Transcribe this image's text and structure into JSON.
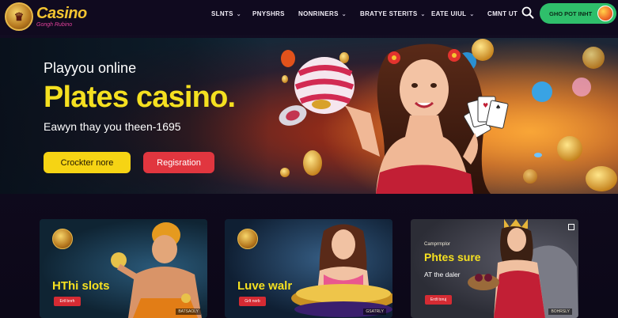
{
  "brand": {
    "name": "Casino",
    "tagline": "Gongh Rubino"
  },
  "nav": [
    {
      "label": "SLNTS",
      "has_menu": true
    },
    {
      "label": "PNYSHRS",
      "has_menu": false
    },
    {
      "label": "NONRINERS",
      "has_menu": true
    },
    {
      "label": "BRATYE STERITS",
      "has_menu": true
    },
    {
      "label": "EATE UIUL",
      "has_menu": true
    },
    {
      "label": "CMNT UT",
      "has_menu": false
    }
  ],
  "header": {
    "cta_label": "GHO POT INHT"
  },
  "hero": {
    "eyebrow": "Playyou online",
    "title": "Plates casino.",
    "subtitle": "Eawyn thay you theen-1695",
    "primary_button": "Crockter nore",
    "secondary_button": "Regisration"
  },
  "cards": [
    {
      "title": "HThi slots",
      "button": "Ertl bnrh",
      "tag": "BATSAOLY"
    },
    {
      "title": "Luve walr",
      "button": "Grlt norb",
      "tag": "GSATRLY"
    },
    {
      "kicker": "Camprmplor",
      "title": "Phtes sure",
      "subtitle": "AT the daler",
      "button": "Erdt toruj",
      "tag": "BOHRSLY"
    }
  ],
  "colors": {
    "accent_yellow": "#f6d414",
    "accent_red": "#e1363f",
    "cta_green": "#2fbf6b",
    "background": "#0f0a1c"
  }
}
